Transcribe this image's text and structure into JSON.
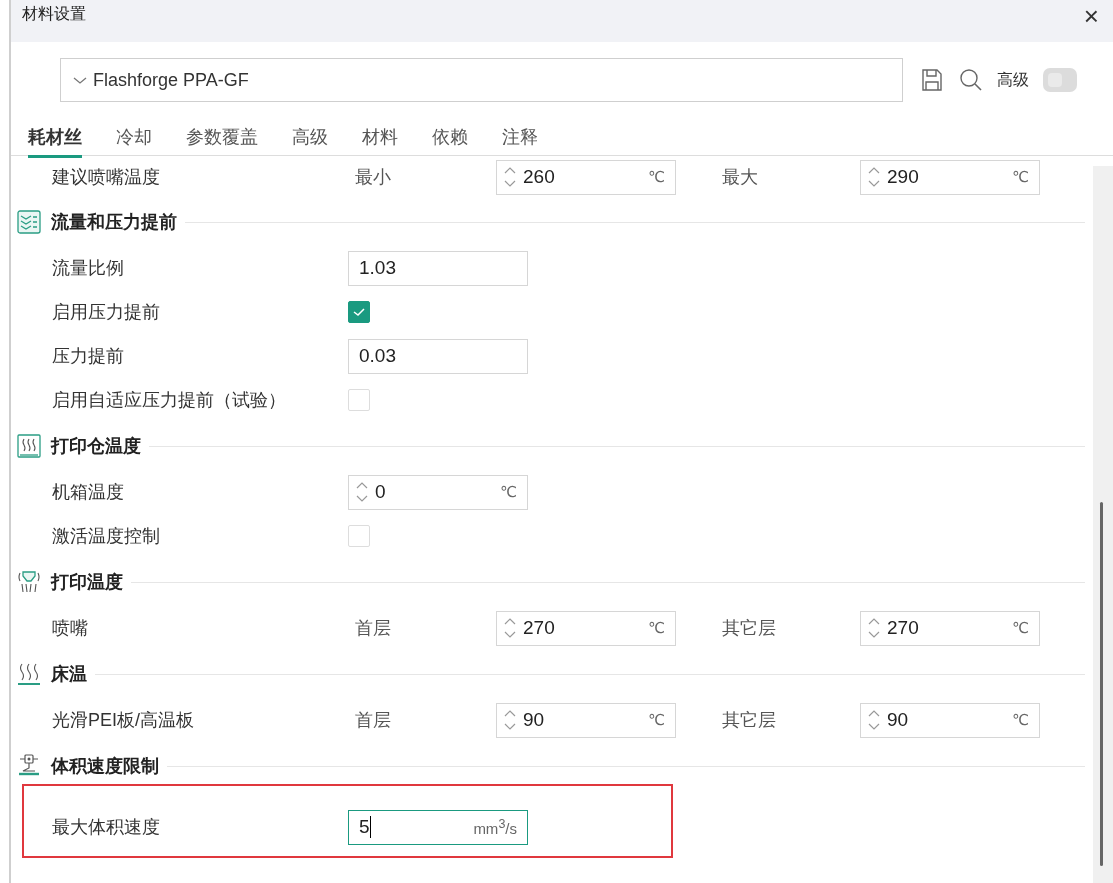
{
  "window": {
    "title": "材料设置",
    "close": "×"
  },
  "preset": {
    "value": "Flashforge PPA-GF"
  },
  "advanced": {
    "label": "高级",
    "on": false
  },
  "tabs": [
    {
      "label": "耗材丝",
      "selected": true
    },
    {
      "label": "冷却",
      "selected": false
    },
    {
      "label": "参数覆盖",
      "selected": false
    },
    {
      "label": "高级",
      "selected": false
    },
    {
      "label": "材料",
      "selected": false
    },
    {
      "label": "依赖",
      "selected": false
    },
    {
      "label": "注释",
      "selected": false
    }
  ],
  "groups": [
    {
      "rows": [
        {
          "kind": "pair",
          "label": "建议喷嘴温度",
          "first_label": "最小",
          "first": {
            "value": "260",
            "unit": "℃",
            "spinner": true
          },
          "second_label": "最大",
          "second": {
            "value": "290",
            "unit": "℃",
            "spinner": true
          }
        }
      ]
    },
    {
      "title": "流量和压力提前",
      "kind": "flow",
      "rows": [
        {
          "kind": "field",
          "label": "流量比例",
          "field": {
            "value": "1.03",
            "spinner": false
          }
        },
        {
          "kind": "check",
          "label": "启用压力提前",
          "checked": true
        },
        {
          "kind": "field",
          "label": "压力提前",
          "field": {
            "value": "0.03",
            "spinner": false
          }
        },
        {
          "kind": "check",
          "label": "启用自适应压力提前（试验）",
          "checked": false
        }
      ]
    },
    {
      "title": "打印仓温度",
      "kind": "chamber",
      "rows": [
        {
          "kind": "field",
          "label": "机箱温度",
          "field": {
            "value": "0",
            "unit": "℃",
            "spinner": true
          }
        },
        {
          "kind": "check",
          "label": "激活温度控制",
          "checked": false
        }
      ]
    },
    {
      "title": "打印温度",
      "kind": "nozzle",
      "rows": [
        {
          "kind": "pair",
          "label": "喷嘴",
          "first_label": "首层",
          "first": {
            "value": "270",
            "unit": "℃",
            "spinner": true
          },
          "second_label": "其它层",
          "second": {
            "value": "270",
            "unit": "℃",
            "spinner": true
          }
        }
      ]
    },
    {
      "title": "床温",
      "kind": "bed",
      "rows": [
        {
          "kind": "pair",
          "label": "光滑PEI板/高温板",
          "first_label": "首层",
          "first": {
            "value": "90",
            "unit": "℃",
            "spinner": true
          },
          "second_label": "其它层",
          "second": {
            "value": "90",
            "unit": "℃",
            "spinner": true
          }
        }
      ]
    },
    {
      "title": "体积速度限制",
      "kind": "volume",
      "rows": [
        {
          "kind": "field",
          "label": "最大体积速度",
          "highlighted": true,
          "field": {
            "value": "5",
            "unit": "mm$^{3}$/s",
            "spinner": false,
            "focused": true
          }
        }
      ]
    }
  ]
}
